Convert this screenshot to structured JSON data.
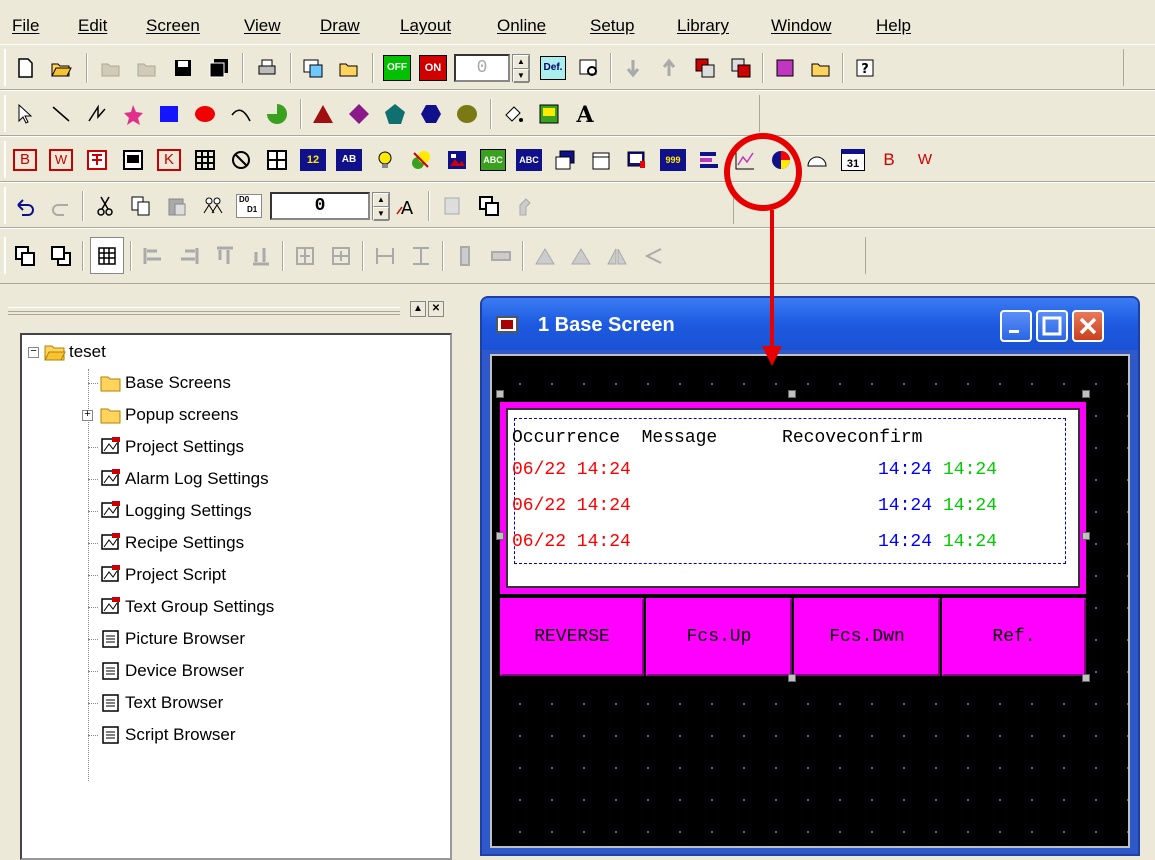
{
  "menu": {
    "items": [
      "File",
      "Edit",
      "Screen",
      "View",
      "Draw",
      "Layout",
      "Online",
      "Setup",
      "Library",
      "Window",
      "Help"
    ]
  },
  "toolbar1": {
    "off_label": "OFF",
    "on_label": "ON",
    "state_value": "0",
    "def_label": "Def."
  },
  "toolbar3": {
    "b_label": "B",
    "w_label": "W",
    "k_label": "K",
    "n12_label": "12",
    "ab_label": "AB",
    "abc_label": "ABC",
    "abc2_label": "ABC",
    "n31_label": "31",
    "b2_label": "B",
    "w2_label": "W",
    "n999_label": "999"
  },
  "toolbar4": {
    "value": "0",
    "d0_label": "D0",
    "d1_label": "D1"
  },
  "tree": {
    "root": "teset",
    "items": [
      "Base Screens",
      "Popup screens",
      "Project Settings",
      "Alarm Log Settings",
      "Logging Settings",
      "Recipe Settings",
      "Project Script",
      "Text Group Settings",
      "Picture Browser",
      "Device Browser",
      "Text Browser",
      "Script Browser"
    ]
  },
  "window": {
    "title": "1  Base Screen"
  },
  "alarm_table": {
    "header": "Occurrence  Message      Recoveconfirm",
    "rows": [
      {
        "occurrence": "06/22 14:24",
        "recover": "14:24",
        "confirm": "14:24"
      },
      {
        "occurrence": "06/22 14:24",
        "recover": "14:24",
        "confirm": "14:24"
      },
      {
        "occurrence": "06/22 14:24",
        "recover": "14:24",
        "confirm": "14:24"
      }
    ],
    "colors": {
      "occurrence": "#ff0000",
      "recover": "#0000ff",
      "confirm": "#00cc00"
    }
  },
  "function_buttons": [
    "REVERSE",
    "Fcs.Up",
    "Fcs.Dwn",
    "Ref."
  ],
  "colors": {
    "annotation": "#e60000",
    "button_fill": "#ff00ff"
  }
}
